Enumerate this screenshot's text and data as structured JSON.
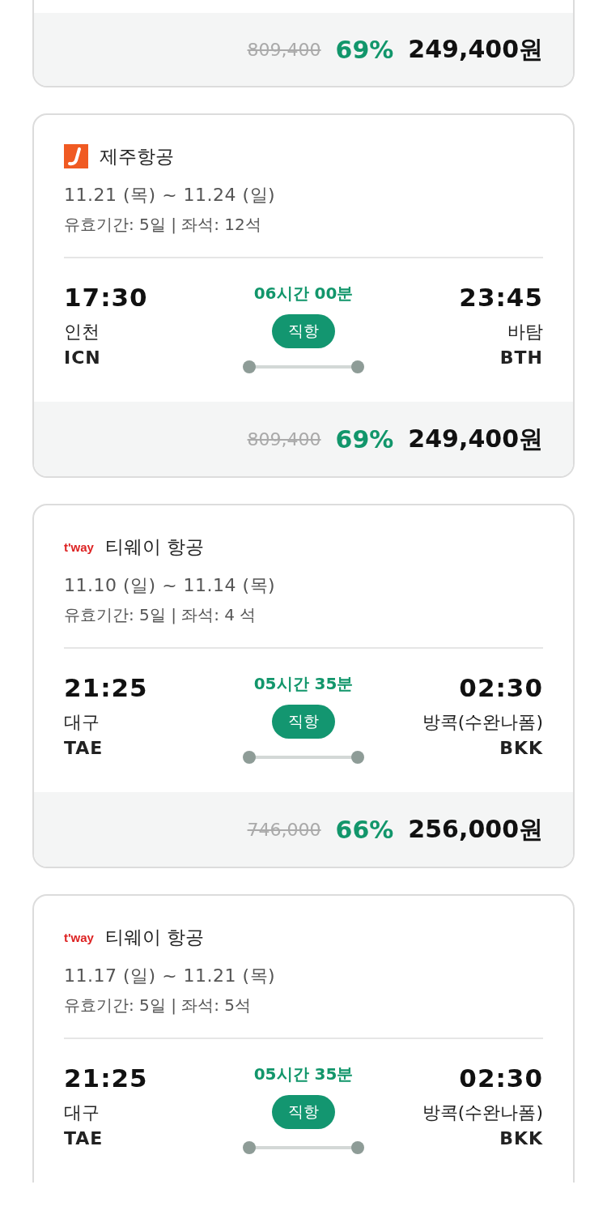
{
  "flights": [
    {
      "kind": "price_only",
      "original_price": "809,400",
      "discount": "69%",
      "price": "249,400원"
    },
    {
      "kind": "full",
      "airline": {
        "kind": "jeju",
        "name": "제주항공"
      },
      "dates": "11.21 (목) ~ 11.24 (일)",
      "info": "유효기간: 5일 | 좌석: 12석",
      "depart": {
        "time": "17:30",
        "city": "인천",
        "code": "ICN"
      },
      "duration": "06시간 00분",
      "route_type": "직항",
      "arrive": {
        "time": "23:45",
        "city": "바탐",
        "code": "BTH"
      },
      "original_price": "809,400",
      "discount": "69%",
      "price": "249,400원"
    },
    {
      "kind": "full",
      "airline": {
        "kind": "tway",
        "logo_text": "t'way",
        "name": "티웨이 항공"
      },
      "dates": "11.10 (일) ~ 11.14 (목)",
      "info": "유효기간: 5일 | 좌석: 4 석",
      "depart": {
        "time": "21:25",
        "city": "대구",
        "code": "TAE"
      },
      "duration": "05시간 35분",
      "route_type": "직항",
      "arrive": {
        "time": "02:30",
        "city": "방콕(수완나폼)",
        "code": "BKK"
      },
      "original_price": "746,000",
      "discount": "66%",
      "price": "256,000원"
    },
    {
      "kind": "no_price",
      "airline": {
        "kind": "tway",
        "logo_text": "t'way",
        "name": "티웨이 항공"
      },
      "dates": "11.17 (일) ~ 11.21 (목)",
      "info": "유효기간: 5일 | 좌석: 5석",
      "depart": {
        "time": "21:25",
        "city": "대구",
        "code": "TAE"
      },
      "duration": "05시간 35분",
      "route_type": "직항",
      "arrive": {
        "time": "02:30",
        "city": "방콕(수완나폼)",
        "code": "BKK"
      }
    }
  ]
}
